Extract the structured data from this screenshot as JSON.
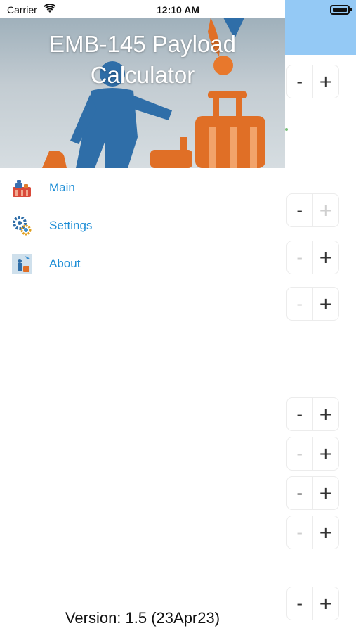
{
  "status_bar": {
    "carrier": "Carrier",
    "time": "12:10 AM",
    "icons": [
      "wifi-icon",
      "battery-icon"
    ]
  },
  "drawer": {
    "title": "EMB-145 Payload Calculator",
    "menu": [
      {
        "label": "Main",
        "icon": "luggage-icon"
      },
      {
        "label": "Settings",
        "icon": "gears-icon"
      },
      {
        "label": "About",
        "icon": "traveler-icon"
      }
    ],
    "version": "Version: 1.5 (23Apr23)"
  },
  "background": {
    "steppers": [
      {
        "minus": "-",
        "plus": "+",
        "minus_enabled": true,
        "plus_enabled": true
      },
      {
        "minus": "-",
        "plus": "+",
        "minus_enabled": true,
        "plus_enabled": false
      },
      {
        "minus": "-",
        "plus": "+",
        "minus_enabled": false,
        "plus_enabled": true
      },
      {
        "minus": "-",
        "plus": "+",
        "minus_enabled": false,
        "plus_enabled": true
      },
      {
        "minus": "-",
        "plus": "+",
        "minus_enabled": true,
        "plus_enabled": true
      },
      {
        "minus": "-",
        "plus": "+",
        "minus_enabled": false,
        "plus_enabled": true
      },
      {
        "minus": "-",
        "plus": "+",
        "minus_enabled": true,
        "plus_enabled": true
      },
      {
        "minus": "-",
        "plus": "+",
        "minus_enabled": false,
        "plus_enabled": true
      },
      {
        "minus": "-",
        "plus": "+",
        "minus_enabled": true,
        "plus_enabled": true
      }
    ],
    "colors": {
      "header": "#94c9f5",
      "link": "#1e8ed6"
    }
  }
}
